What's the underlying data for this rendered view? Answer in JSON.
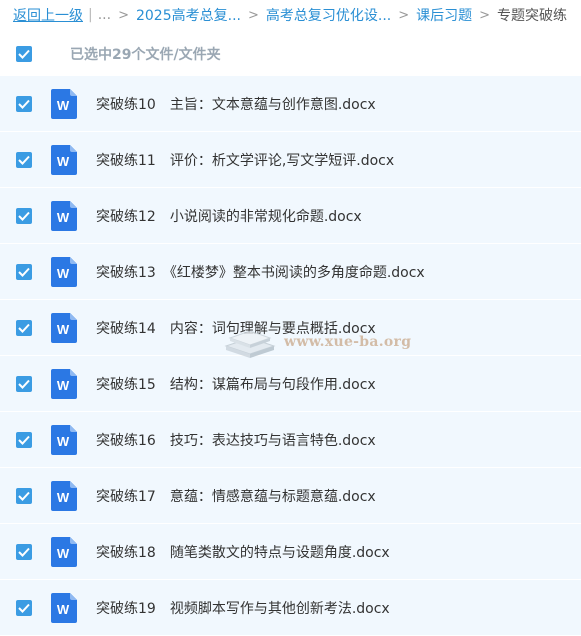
{
  "breadcrumb": {
    "back_label": "返回上一级",
    "separator": "|",
    "ellipsis": "...",
    "arrow": ">",
    "items": [
      {
        "label": "2025高考总复..."
      },
      {
        "label": "高考总复习优化设..."
      },
      {
        "label": "课后习题"
      }
    ],
    "current": "专题突破练"
  },
  "selection": {
    "label": "已选中29个文件/文件夹",
    "checked": true
  },
  "file_icon": "word-doc-icon",
  "files": [
    {
      "name": "突破练10　主旨：文本意蕴与创作意图.docx",
      "checked": true
    },
    {
      "name": "突破练11　评价：析文学评论,写文学短评.docx",
      "checked": true
    },
    {
      "name": "突破练12　小说阅读的非常规化命题.docx",
      "checked": true
    },
    {
      "name": "突破练13　《红楼梦》整本书阅读的多角度命题.docx",
      "checked": true
    },
    {
      "name": "突破练14　内容：词句理解与要点概括.docx",
      "checked": true
    },
    {
      "name": "突破练15　结构：谋篇布局与句段作用.docx",
      "checked": true
    },
    {
      "name": "突破练16　技巧：表达技巧与语言特色.docx",
      "checked": true
    },
    {
      "name": "突破练17　意蕴：情感意蕴与标题意蕴.docx",
      "checked": true
    },
    {
      "name": "突破练18　随笔类散文的特点与设题角度.docx",
      "checked": true
    },
    {
      "name": "突破练19　视频脚本写作与其他创新考法.docx",
      "checked": true
    }
  ],
  "watermark": {
    "text": "www.xue-ba.org"
  },
  "colors": {
    "accent": "#3b9ce3",
    "link": "#2a8fd4",
    "row_bg": "#f1f8fe",
    "word_blue": "#2b78e4"
  }
}
